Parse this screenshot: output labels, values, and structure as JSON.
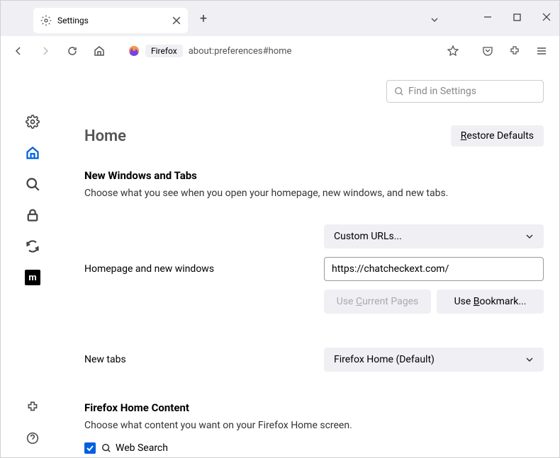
{
  "tab": {
    "title": "Settings"
  },
  "toolbar": {
    "tag": "Firefox",
    "url": "about:preferences#home"
  },
  "search": {
    "placeholder": "Find in Settings"
  },
  "home": {
    "title": "Home",
    "restore": "Restore Defaults",
    "section1": {
      "heading": "New Windows and Tabs",
      "desc": "Choose what you see when you open your homepage, new windows, and new tabs."
    },
    "row1": {
      "label": "Homepage and new windows",
      "select": "Custom URLs...",
      "url": "https://chatcheckext.com/"
    },
    "btns": {
      "a": "Use Current Pages",
      "b": "Use Bookmark..."
    },
    "row2": {
      "label": "New tabs",
      "select": "Firefox Home (Default)"
    },
    "section2": {
      "heading": "Firefox Home Content",
      "desc": "Choose what content you want on your Firefox Home screen."
    },
    "websearch": "Web Search"
  }
}
